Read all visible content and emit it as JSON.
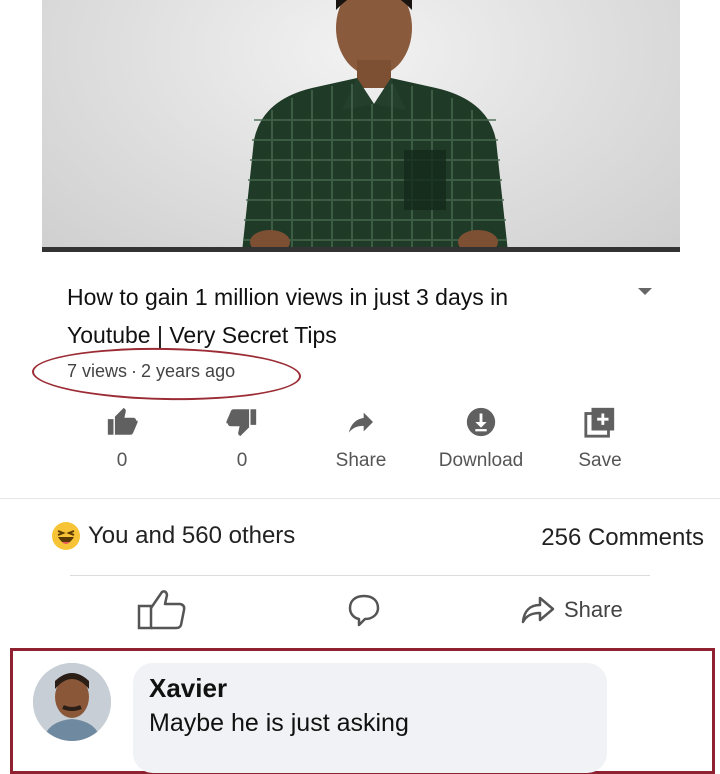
{
  "video": {
    "title_line1": "How to gain 1 million views in just 3 days in",
    "title_line2": "Youtube | Very Secret Tips",
    "views": "7 views",
    "age": "2 years ago",
    "separator": "·"
  },
  "video_actions": [
    {
      "name": "like",
      "icon": "thumbs-up-icon",
      "label": "0"
    },
    {
      "name": "dislike",
      "icon": "thumbs-down-icon",
      "label": "0"
    },
    {
      "name": "share",
      "icon": "share-arrow-icon",
      "label": "Share"
    },
    {
      "name": "download",
      "icon": "download-icon",
      "label": "Download"
    },
    {
      "name": "save",
      "icon": "add-to-playlist-icon",
      "label": "Save"
    }
  ],
  "post": {
    "reactions_text": "You and 560 others",
    "comments_count": "256 Comments",
    "share_label": "Share"
  },
  "comment": {
    "author": "Xavier",
    "text": "Maybe he is just asking"
  },
  "colors": {
    "highlight": "#9b2b34",
    "facebook_bg": "#f0f2f5"
  }
}
